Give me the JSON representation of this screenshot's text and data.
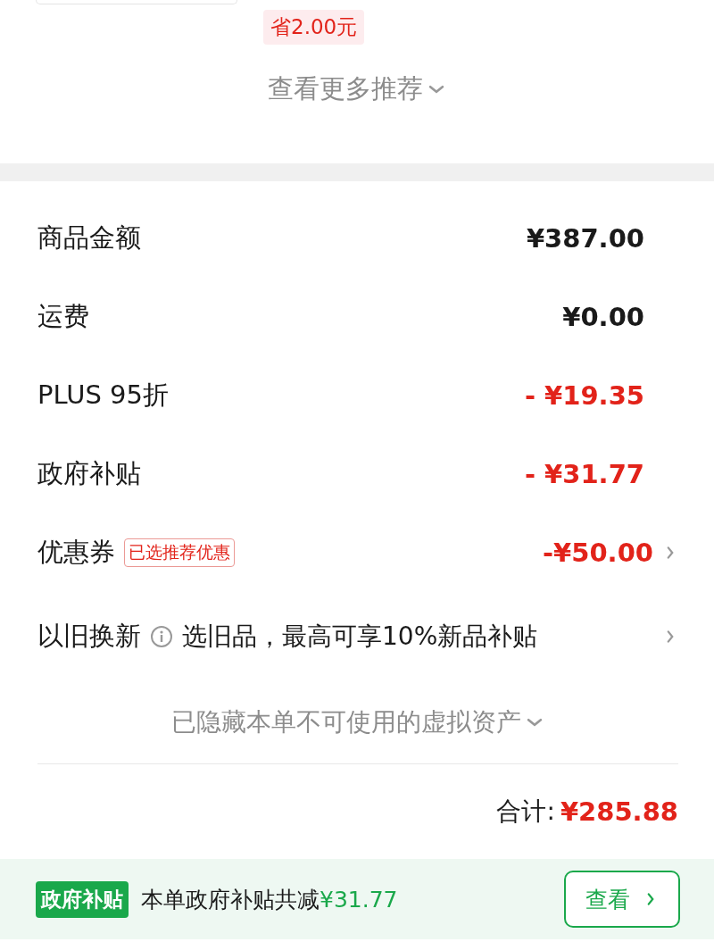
{
  "recommend": {
    "saving_tag": "省2.00元",
    "more_link": "查看更多推荐"
  },
  "summary": {
    "rows": [
      {
        "kind": "amount",
        "label": "商品金额",
        "amount": "¥387.00",
        "deduction": false
      },
      {
        "kind": "amount",
        "label": "运费",
        "amount": "¥0.00",
        "deduction": false
      },
      {
        "kind": "amount",
        "label": "PLUS 95折",
        "amount": "- ¥19.35",
        "deduction": true
      },
      {
        "kind": "amount",
        "label": "政府补贴",
        "amount": "- ¥31.77",
        "deduction": true
      },
      {
        "kind": "coupon",
        "label": "优惠券",
        "tag": "已选推荐优惠",
        "amount": "-¥50.00",
        "deduction": true
      },
      {
        "kind": "trade_in",
        "label": "以旧换新",
        "hint": "选旧品，最高可享10%新品补贴"
      }
    ],
    "hidden_assets": "已隐藏本单不可使用的虚拟资产",
    "total_label": "合计:",
    "total": "¥285.88"
  },
  "subsidy_bar": {
    "badge": "政府补贴",
    "text": "本单政府补贴共减",
    "amount": "¥31.77",
    "button": "查看"
  }
}
